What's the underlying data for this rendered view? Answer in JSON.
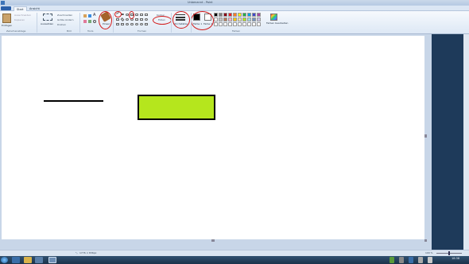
{
  "window": {
    "title": "Unbenannt - Paint"
  },
  "tabs": [
    {
      "label": "Start"
    },
    {
      "label": "Ansicht"
    }
  ],
  "clipboard": {
    "paste_label": "Einfügen",
    "cut_label": "Ausschneiden",
    "copy_label": "Kopieren",
    "group_label": "Zwischenablage"
  },
  "image": {
    "select_label": "Auswählen",
    "crop_label": "Zuschneiden",
    "resize_label": "Größe ändern",
    "rotate_label": "Drehen",
    "group_label": "Bild"
  },
  "tools": {
    "group_label": "Tools",
    "brushes_label": "Pinsel"
  },
  "shapes": {
    "outline_label": "Kontur",
    "fill_label": "Füllen",
    "group_label": "Formen"
  },
  "size": {
    "label": "Strichstärke"
  },
  "colors": {
    "color1_label": "Farbe 1",
    "color2_label": "Farbe 2",
    "edit_label": "Farben bearbeiten",
    "group_label": "Farben",
    "color1": "#000000",
    "color2": "#ffffff",
    "palette": [
      "#000000",
      "#7f7f7f",
      "#880015",
      "#ed1c24",
      "#ff7f27",
      "#fff200",
      "#22b14c",
      "#00a2e8",
      "#3f48cc",
      "#a349a4",
      "#ffffff",
      "#c3c3c3",
      "#b97a57",
      "#ffaec9",
      "#ffc90e",
      "#efe4b0",
      "#b5e61d",
      "#99d9ea",
      "#7092be",
      "#c8bfe7",
      "#ffffff",
      "#ffffff",
      "#ffffff",
      "#ffffff",
      "#ffffff",
      "#ffffff",
      "#ffffff",
      "#ffffff",
      "#ffffff",
      "#ffffff"
    ]
  },
  "drawing": {
    "line_color": "#000000",
    "rect_fill": "#b5e61d",
    "rect_stroke": "#000000"
  },
  "statusbar": {
    "size_text": "1776 × 836px",
    "zoom": "100 %"
  },
  "taskbar": {
    "time": "18:38"
  },
  "accent": {
    "annotation": "#d21a1a"
  }
}
